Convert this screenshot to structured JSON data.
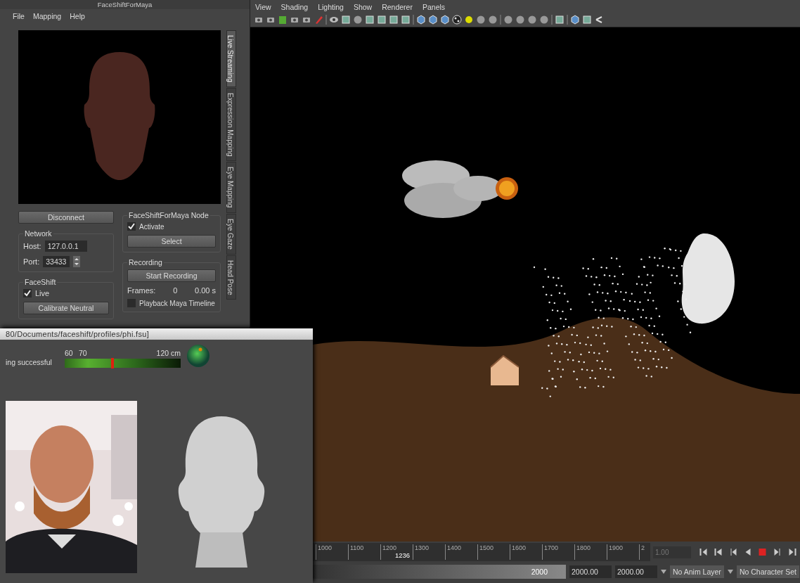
{
  "faceshift_panel": {
    "title": "FaceShiftForMaya",
    "menu": [
      "File",
      "Mapping",
      "Help"
    ],
    "tabs": [
      {
        "label": "Live Streaming",
        "selected": true
      },
      {
        "label": "Expression Mapping",
        "selected": false
      },
      {
        "label": "Eye Mapping",
        "selected": false
      },
      {
        "label": "Eye Gaze",
        "selected": false
      },
      {
        "label": "Head Pose",
        "selected": false
      }
    ],
    "disconnect_button": "Disconnect",
    "network": {
      "title": "Network",
      "host_label": "Host:",
      "host": "127.0.0.1",
      "port_label": "Port:",
      "port": "33433"
    },
    "faceshift": {
      "title": "FaceShift",
      "live": {
        "label": "Live",
        "checked": true
      },
      "calibrate_button": "Calibrate Neutral"
    },
    "node": {
      "title": "FaceShiftForMaya Node",
      "activate": {
        "label": "Activate",
        "checked": true
      },
      "select_button": "Select"
    },
    "recording": {
      "title": "Recording",
      "start_button": "Start Recording",
      "frames_label": "Frames:",
      "frames": "0",
      "time": "0.00 s",
      "playback": {
        "label": "Playback Maya Timeline",
        "checked": false
      }
    }
  },
  "viewport": {
    "menu": [
      "View",
      "Shading",
      "Lighting",
      "Show",
      "Renderer",
      "Panels"
    ]
  },
  "timeline": {
    "ticks": [
      "1000",
      "1100",
      "1200",
      "1300",
      "1400",
      "1500",
      "1600",
      "1700",
      "1800",
      "1900",
      "2"
    ],
    "current_frame": "1236",
    "time_field": "1.00",
    "range": {
      "end": "2000",
      "level": 1
    },
    "end_fields": [
      "2000.00",
      "2000.00"
    ],
    "anim_layer": "No Anim Layer",
    "character_set": "No Character Set"
  },
  "tracker": {
    "path": "80/Documents/faceshift/profiles/phi.fsu]",
    "status": "ing successful",
    "scale": [
      "60",
      "70",
      "120 cm"
    ],
    "level": 0.41
  }
}
